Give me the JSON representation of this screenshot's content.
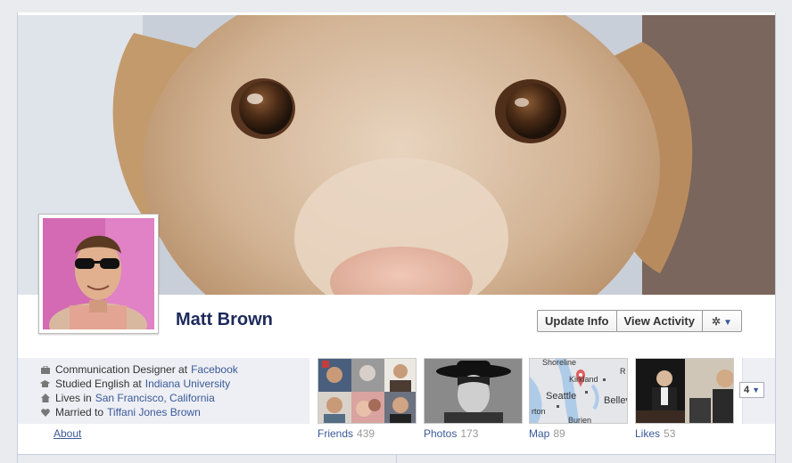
{
  "profile": {
    "name": "Matt Brown"
  },
  "actions": {
    "update_info": "Update Info",
    "view_activity": "View Activity",
    "settings_icon": "gear-icon"
  },
  "info": {
    "work": {
      "prefix": "Communication Designer at",
      "link": "Facebook",
      "icon": "briefcase-icon"
    },
    "education": {
      "prefix": "Studied English at",
      "link": "Indiana University",
      "icon": "graduation-icon"
    },
    "location": {
      "prefix": "Lives in",
      "link": "San Francisco, California",
      "icon": "house-icon"
    },
    "relationship": {
      "prefix": "Married to",
      "link": "Tiffani Jones Brown",
      "icon": "heart-icon"
    }
  },
  "tabs": {
    "about": "About",
    "friends": {
      "label": "Friends",
      "count": "439"
    },
    "photos": {
      "label": "Photos",
      "count": "173"
    },
    "map": {
      "label": "Map",
      "count": "89",
      "places": [
        "Shoreline",
        "Kirkland",
        "Seattle",
        "Bellevue",
        "rton",
        "Burien",
        "R"
      ]
    },
    "likes": {
      "label": "Likes",
      "count": "53"
    },
    "more": "4"
  },
  "colors": {
    "link": "#3b5998",
    "name": "#1d2a5b",
    "info_bg": "#edeff4"
  }
}
